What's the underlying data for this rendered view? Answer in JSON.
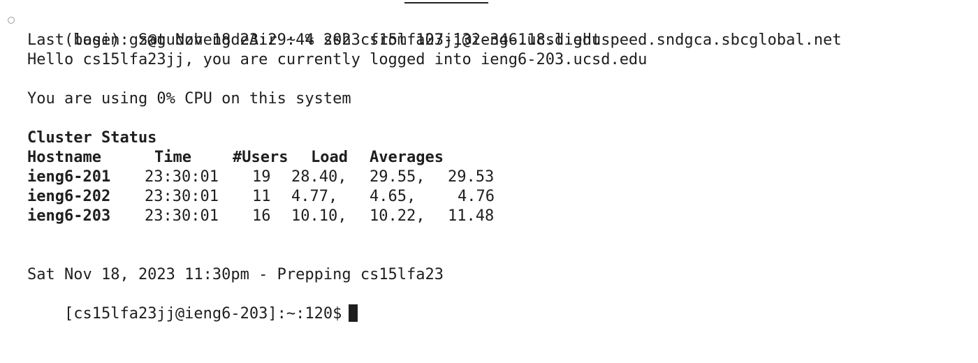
{
  "terminal": {
    "command_line": {
      "prompt": "(base) gz@guozhengdeAir ~ % ",
      "command": "ssh cs15lfa23jj@ieng6.ucsd.edu"
    },
    "last_login": "Last login: Sat Nov 18 23:29:44 2023 from 107-132-34-118.lightspeed.sndgca.sbcglobal.net",
    "hello": "Hello cs15lfa23jj, you are currently logged into ieng6-203.ucsd.edu",
    "cpu_usage": "You are using 0% CPU on this system",
    "cluster": {
      "title": "Cluster Status",
      "headers": {
        "hostname": "Hostname",
        "time": "Time",
        "users": "#Users",
        "load": "Load",
        "averages": "Averages"
      },
      "rows": [
        {
          "hostname": "ieng6-201",
          "time": "23:30:01",
          "users": "19",
          "load1": "28.40,",
          "load5": "29.55,",
          "load15": "29.53"
        },
        {
          "hostname": "ieng6-202",
          "time": "23:30:01",
          "users": "11",
          "load1": "4.77,",
          "load5": "4.65,",
          "load15": "4.76"
        },
        {
          "hostname": "ieng6-203",
          "time": "23:30:01",
          "users": "16",
          "load1": "10.10,",
          "load5": "10.22,",
          "load15": "11.48"
        }
      ]
    },
    "prep_message": "Sat Nov 18, 2023 11:30pm - Prepping cs15lfa23",
    "shell_prompt": "[cs15lfa23jj@ieng6-203]:~:120$"
  }
}
